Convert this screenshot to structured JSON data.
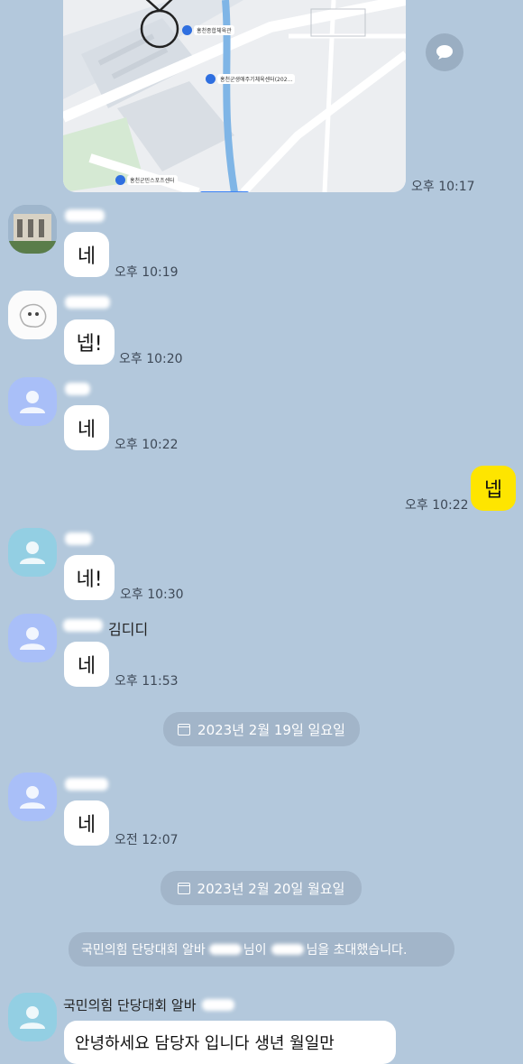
{
  "map": {
    "places": [
      "홍천종합체육관",
      "홍천군생애주기체육센터(202...",
      "홍천군민스포츠센터"
    ]
  },
  "messages": [
    {
      "sender": "",
      "text": "",
      "time": "오후 10:17"
    },
    {
      "sender": "",
      "text": "네",
      "time": "오후 10:19"
    },
    {
      "sender": "",
      "text": "넵!",
      "time": "오후 10:20"
    },
    {
      "sender": "",
      "text": "네",
      "time": "오후 10:22"
    },
    {
      "sender": "me",
      "text": "넵",
      "time": "오후 10:22"
    },
    {
      "sender": "",
      "text": "네!",
      "time": "오후 10:30"
    },
    {
      "sender": "김디디",
      "text": "네",
      "time": "오후 11:53"
    },
    {
      "sender": "",
      "text": "네",
      "time": "오전 12:07"
    },
    {
      "sender": "국민의힘 단당대회 알바",
      "text": "안녕하세요 담당자 입니다 생년 월일만",
      "time": ""
    }
  ],
  "dates": [
    "2023년 2월 19일 일요일",
    "2023년 2월 20일 월요일"
  ],
  "system": {
    "part1": "국민의힘 단당대회 알바",
    "part2": "님이",
    "part3": "님을 초대했습니다."
  },
  "colors": {
    "background": "#b3c8dc",
    "my_bubble": "#fee500",
    "other_bubble": "#ffffff"
  }
}
